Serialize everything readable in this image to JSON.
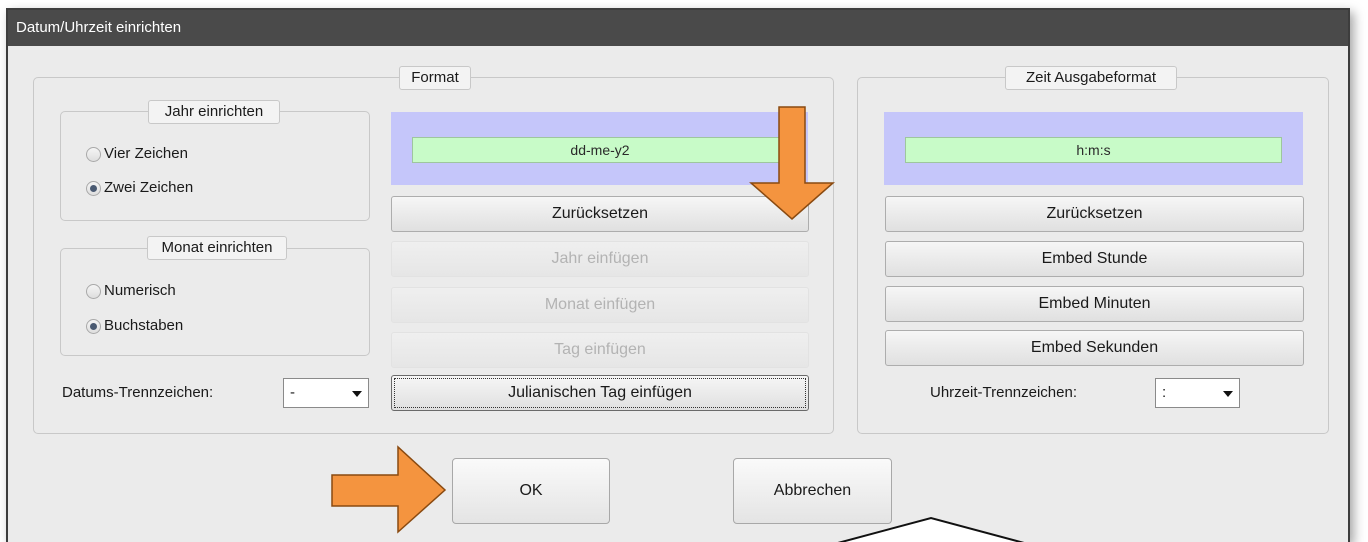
{
  "window": {
    "title": "Datum/Uhrzeit einrichten"
  },
  "format_group": {
    "legend": "Format",
    "year_group": {
      "legend": "Jahr einrichten",
      "options": [
        {
          "label": "Vier Zeichen",
          "checked": false
        },
        {
          "label": "Zwei Zeichen",
          "checked": true
        }
      ]
    },
    "month_group": {
      "legend": "Monat einrichten",
      "options": [
        {
          "label": "Numerisch",
          "checked": false
        },
        {
          "label": "Buchstaben",
          "checked": true
        }
      ]
    },
    "preview_value": "dd-me-y2",
    "buttons": {
      "reset": "Zurücksetzen",
      "insert_year": "Jahr einfügen",
      "insert_month": "Monat einfügen",
      "insert_day": "Tag einfügen",
      "insert_julian": "Julianischen Tag einfügen"
    },
    "separator_label": "Datums-Trennzeichen:",
    "separator_value": "-"
  },
  "time_group": {
    "legend": "Zeit Ausgabeformat",
    "preview_value": "h:m:s",
    "buttons": {
      "reset": "Zurücksetzen",
      "embed_hour": "Embed Stunde",
      "embed_minutes": "Embed Minuten",
      "embed_seconds": "Embed Sekunden"
    },
    "separator_label": "Uhrzeit-Trennzeichen:",
    "separator_value": ":"
  },
  "footer": {
    "ok": "OK",
    "cancel": "Abbrechen"
  },
  "colors": {
    "annotation_arrow": "#f4943f",
    "preview_background": "#c5c6fa",
    "preview_field": "#c8fbc8",
    "titlebar": "#4a4a4a"
  }
}
